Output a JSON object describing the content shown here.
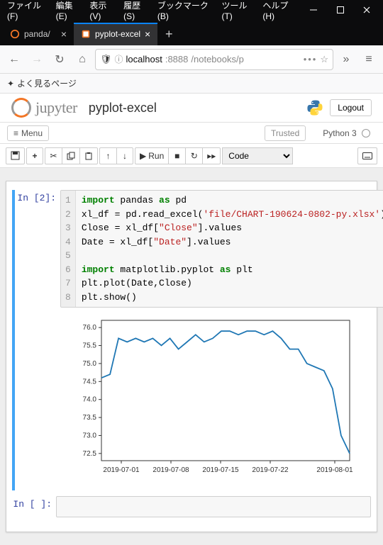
{
  "browser": {
    "menus": [
      "ファイル(F)",
      "編集(E)",
      "表示(V)",
      "履歴(S)",
      "ブックマーク(B)",
      "ツール(T)",
      "ヘルプ(H)"
    ],
    "tabs": [
      {
        "title": "panda/",
        "active": false
      },
      {
        "title": "pyplot-excel",
        "active": true
      }
    ],
    "url_host": "localhost",
    "url_port": ":8888",
    "url_path": "/notebooks/p",
    "bookmark_label": "よく見るページ"
  },
  "jupyter": {
    "logo_text": "jupyter",
    "notebook_name": "pyplot-excel",
    "logout": "Logout",
    "menu_label": "Menu",
    "trusted": "Trusted",
    "kernel": "Python 3",
    "run_label": "Run",
    "celltype": "Code"
  },
  "cell1": {
    "prompt": "In [2]:",
    "lines": [
      "1",
      "2",
      "3",
      "4",
      "5",
      "6",
      "7",
      "8"
    ]
  },
  "cell2": {
    "prompt": "In [ ]:"
  },
  "chart_data": {
    "type": "line",
    "title": "",
    "xlabel": "",
    "ylabel": "",
    "x_tick_labels": [
      "2019-07-01",
      "2019-07-08",
      "2019-07-15",
      "2019-07-22",
      "2019-08-01"
    ],
    "y_ticks": [
      72.5,
      73.0,
      73.5,
      74.0,
      74.5,
      75.0,
      75.5,
      76.0
    ],
    "ylim": [
      72.3,
      76.2
    ],
    "series": [
      {
        "name": "Close",
        "values": [
          74.6,
          74.7,
          75.7,
          75.6,
          75.7,
          75.6,
          75.7,
          75.5,
          75.7,
          75.4,
          75.6,
          75.8,
          75.6,
          75.7,
          75.9,
          75.9,
          75.8,
          75.9,
          75.9,
          75.8,
          75.9,
          75.7,
          75.4,
          75.4,
          75.0,
          74.9,
          74.8,
          74.3,
          73.0,
          72.5
        ]
      }
    ]
  }
}
